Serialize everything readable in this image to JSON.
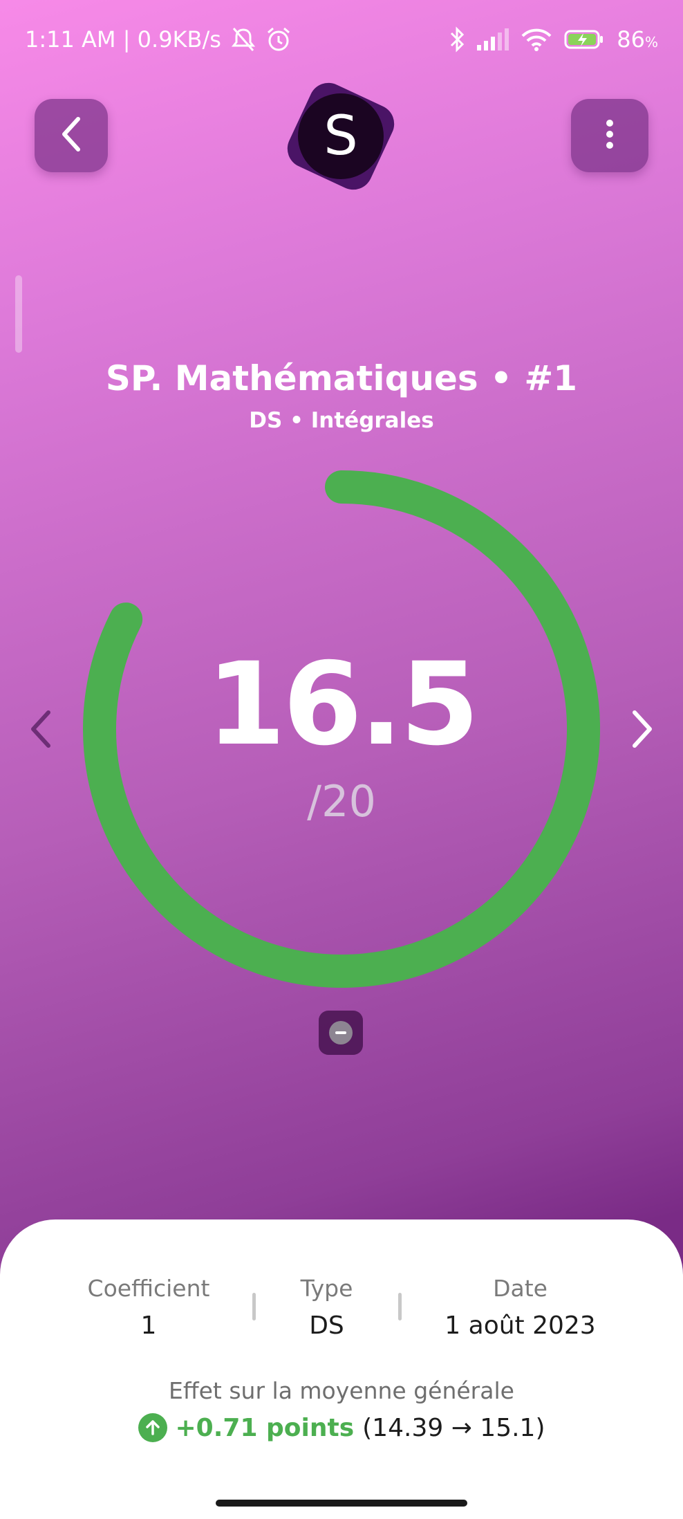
{
  "status_bar": {
    "time_speed": "1:11 AM | 0.9KB/s",
    "battery": "86",
    "battery_unit": "%"
  },
  "header": {
    "logo_letter": "S"
  },
  "subject": {
    "title": "SP. Mathématiques • #1",
    "subtitle": "DS • Intégrales"
  },
  "grade": {
    "value": "16.5",
    "max": "/20",
    "progress_fraction": 0.825,
    "ring_color": "#4caf50"
  },
  "details": {
    "coefficient_label": "Coefficient",
    "coefficient_value": "1",
    "type_label": "Type",
    "type_value": "DS",
    "date_label": "Date",
    "date_value": "1 août 2023"
  },
  "effect": {
    "label": "Effet sur la moyenne générale",
    "points": "+0.71 points",
    "change": "(14.39 → 15.1)",
    "positive_color": "#4caf50"
  }
}
